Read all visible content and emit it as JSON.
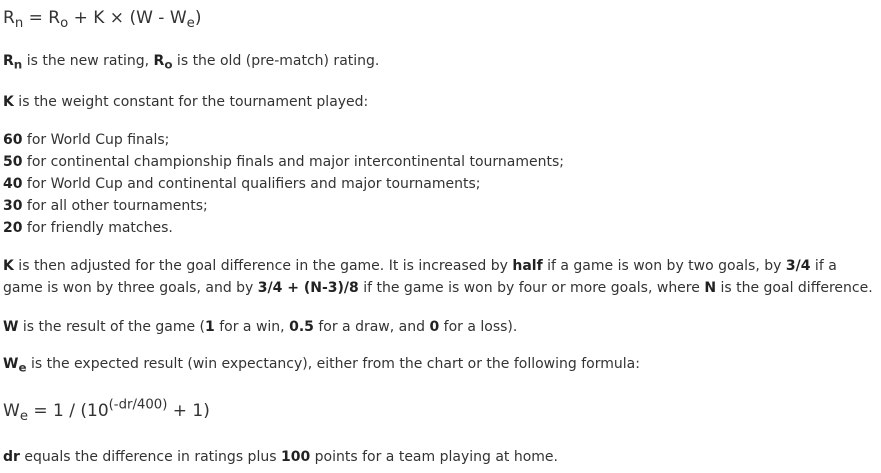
{
  "formula_rn": {
    "lhs_base": "R",
    "lhs_sub": "n",
    "eq": " = ",
    "ro_base": "R",
    "ro_sub": "o",
    "rest_pre": " + K × (W - W",
    "we_sub": "e",
    "rest_post": ")"
  },
  "rn_def": {
    "rn_base": "R",
    "rn_sub": "n",
    "text1": " is the new rating, ",
    "ro_base": "R",
    "ro_sub": "o",
    "text2": " is the old (pre-match) rating."
  },
  "k_def": {
    "k": "K",
    "text": " is the weight constant for the tournament played:"
  },
  "weights": [
    {
      "value": "60",
      "text": " for World Cup finals;"
    },
    {
      "value": "50",
      "text": " for continental championship finals and major intercontinental tournaments;"
    },
    {
      "value": "40",
      "text": " for World Cup and continental qualifiers and major tournaments;"
    },
    {
      "value": "30",
      "text": " for all other tournaments;"
    },
    {
      "value": "20",
      "text": " for friendly matches."
    }
  ],
  "k_adjust": {
    "line1": {
      "k": "K",
      "t1": " is then adjusted for the goal difference in the game. It is increased by ",
      "half": "half",
      "t2": " if a game is won by two goals, by ",
      "three_quarters": "3/4",
      "t3": " if a"
    },
    "line2": {
      "t1": "game is won by three goals, and by ",
      "formula": "3/4 + (N-3)/8",
      "t2": " if the game is won by four or more goals, where ",
      "n": "N",
      "t3": " is the goal difference."
    }
  },
  "w_def": {
    "w": "W",
    "t1": " is the result of the game (",
    "win_val": "1",
    "t2": " for a win, ",
    "draw_val": "0.5",
    "t3": " for a draw, and ",
    "loss_val": "0",
    "t4": " for a loss)."
  },
  "we_def": {
    "w": "W",
    "sub": "e",
    "text": " is the expected result (win expectancy), either from the chart or the following formula:"
  },
  "formula_we": {
    "lhs_base": "W",
    "lhs_sub": "e",
    "mid": " = 1 / (10",
    "exp": "(-dr/400)",
    "end": " + 1)"
  },
  "dr_def": {
    "dr": "dr",
    "t1": " equals the difference in ratings plus ",
    "points": "100",
    "t2": " points for a team playing at home."
  }
}
